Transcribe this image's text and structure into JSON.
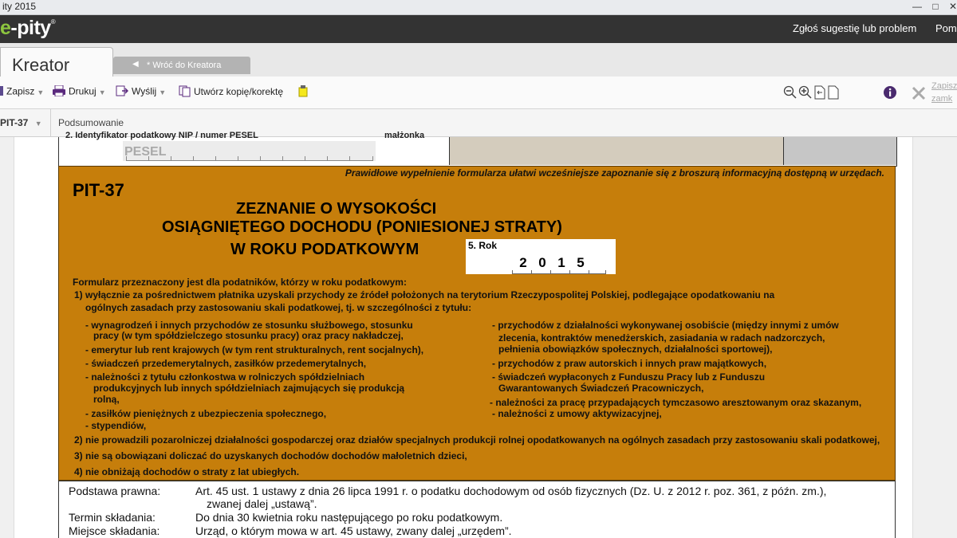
{
  "window": {
    "title": "ity 2015"
  },
  "appbar": {
    "logo_e": "e",
    "logo_rest": "-pity",
    "logo_mark": "®",
    "suggest": "Zgłoś sugestię lub problem",
    "help": "Pom"
  },
  "tabs": {
    "active": "Kreator",
    "back": "* Wróć do Kreatora"
  },
  "toolbar": {
    "save": "Zapisz",
    "print": "Drukuj",
    "send": "Wyślij",
    "copy": "Utwórz kopię/korektę",
    "page": "1",
    "close_top": "Zapisz",
    "close_bottom": "zamk"
  },
  "subbar": {
    "form": "PIT-37",
    "section": "Podsumowanie"
  },
  "form": {
    "cut_label_left": "2. Identyfikator podatkowy NIP / numer PESEL",
    "cut_label_right": "małżonka",
    "pesel_placeholder": "PESEL",
    "notice": "Prawidłowe wypełnienie formularza ułatwi wcześniejsze zapoznanie się z broszurą informacyjną dostępną w urzędach.",
    "code": "PIT-37",
    "title1": "ZEZNANIE O WYSOKOŚCI",
    "title2": "OSIĄGNIĘTEGO DOCHODU (PONIESIONEJ STRATY)",
    "title3": "W ROKU PODATKOWYM",
    "year_label": "5. Rok",
    "year_digits": [
      "2",
      "0",
      "1",
      "5"
    ],
    "intro": "Formularz przeznaczony jest dla podatników, którzy w roku podatkowym:",
    "p1a": "1) wyłącznie za pośrednictwem płatnika uzyskali przychody ze źródeł położonych na terytorium Rzeczypospolitej Polskiej, podlegające opodatkowaniu na",
    "p1b": "ogólnych zasadach przy zastosowaniu skali podatkowej, tj. w szczególności z tytułu:",
    "left_items": [
      "- wynagrodzeń i innych przychodów ze stosunku służbowego, stosunku",
      "pracy (w tym spółdzielczego stosunku pracy) oraz pracy nakładczej,",
      "- emerytur lub rent krajowych (w tym rent strukturalnych, rent socjalnych),",
      "- świadczeń przedemerytalnych, zasiłków przedemerytalnych,",
      "- należności z tytułu członkostwa w rolniczych spółdzielniach",
      "produkcyjnych lub innych spółdzielniach zajmujących się produkcją",
      "rolną,",
      "- zasiłków pieniężnych z ubezpieczenia społecznego,",
      "- stypendiów,"
    ],
    "right_items": [
      "- przychodów z działalności wykonywanej osobiście (między innymi z umów",
      "zlecenia, kontraktów menedżerskich, zasiadania w radach nadzorczych,",
      "pełnienia obowiązków społecznych, działalności sportowej),",
      "- przychodów z praw autorskich i innych praw majątkowych,",
      "- świadczeń wypłaconych z Funduszu Pracy lub z Funduszu",
      "Gwarantowanych Świadczeń Pracowniczych,",
      "- należności za pracę przypadających tymczasowo aresztowanym oraz skazanym,",
      "- należności z umowy aktywizacyjnej,"
    ],
    "p2": "2) nie prowadzili pozarolniczej działalności gospodarczej oraz działów specjalnych produkcji rolnej opodatkowanych na ogólnych zasadach przy zastosowaniu skali podatkowej,",
    "p3": "3) nie są obowiązani doliczać do uzyskanych dochodów dochodów małoletnich dzieci,",
    "p4": "4) nie obniżają dochodów o straty z lat ubiegłych.",
    "legal_label": "Podstawa prawna:",
    "legal_value1": "Art. 45 ust. 1 ustawy z dnia 26 lipca 1991 r. o podatku dochodowym od osób fizycznych (Dz. U. z 2012 r. poz. 361, z późn. zm.),",
    "legal_value2": "zwanej dalej „ustawą”.",
    "deadline_label": "Termin składania:",
    "deadline_value": "Do dnia 30 kwietnia roku następującego po roku podatkowym.",
    "place_label": "Miejsce składania:",
    "place_value": "Urząd, o którym mowa w art. 45 ustawy, zwany dalej „urzędem”."
  },
  "colors": {
    "form_orange": "#c67e0b",
    "appbar": "#333333",
    "logo_green": "#8dc63f"
  },
  "icons": [
    "save-icon",
    "print-icon",
    "send-icon",
    "copy-icon",
    "note-icon",
    "zoom-out-icon",
    "zoom-in-icon",
    "fit-page-icon",
    "single-page-icon",
    "info-icon",
    "close-icon",
    "minimize-icon",
    "maximize-icon"
  ]
}
